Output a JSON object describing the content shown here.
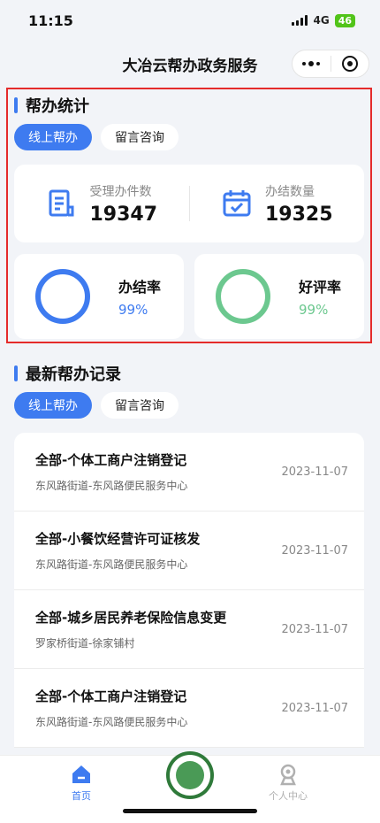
{
  "status": {
    "time": "11:15",
    "network": "4G",
    "battery": "46"
  },
  "nav": {
    "title": "大冶云帮办政务服务",
    "more_icon": "more-dots-icon",
    "close_icon": "target-close-icon"
  },
  "stats": {
    "title": "帮办统计",
    "tabs": [
      {
        "label": "线上帮办",
        "active": true
      },
      {
        "label": "留言咨询",
        "active": false
      }
    ],
    "accepted": {
      "label": "受理办件数",
      "value": "19347",
      "icon": "document-icon"
    },
    "completed": {
      "label": "办结数量",
      "value": "19325",
      "icon": "calendar-check-icon"
    },
    "completion_rate": {
      "label": "办结率",
      "value": "99%",
      "color": "#3e7bf0"
    },
    "praise_rate": {
      "label": "好评率",
      "value": "99%",
      "color": "#6cc88f"
    },
    "highlight_color": "#e52b2b"
  },
  "records": {
    "title": "最新帮办记录",
    "tabs": [
      {
        "label": "线上帮办",
        "active": true
      },
      {
        "label": "留言咨询",
        "active": false
      }
    ],
    "items": [
      {
        "title": "全部-个体工商户注销登记",
        "sub": "东风路街道-东风路便民服务中心",
        "date": "2023-11-07"
      },
      {
        "title": "全部-小餐饮经营许可证核发",
        "sub": "东风路街道-东风路便民服务中心",
        "date": "2023-11-07"
      },
      {
        "title": "全部-城乡居民养老保险信息变更",
        "sub": "罗家桥街道-徐家铺村",
        "date": "2023-11-07"
      },
      {
        "title": "全部-个体工商户注销登记",
        "sub": "东风路街道-东风路便民服务中心",
        "date": "2023-11-07"
      }
    ]
  },
  "tabbar": {
    "home_label": "首页",
    "user_label": "个人中心",
    "accent": "#3e7bf0"
  }
}
